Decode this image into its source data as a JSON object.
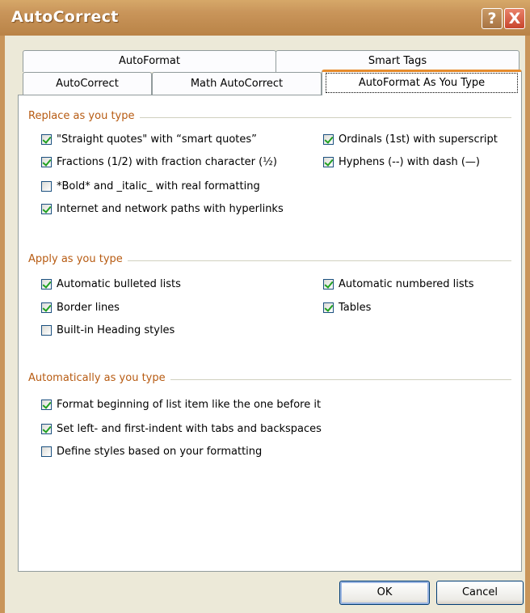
{
  "window": {
    "title": "AutoCorrect",
    "help_symbol": "?",
    "close_symbol": "X"
  },
  "tabs": {
    "row1": [
      {
        "label": "AutoFormat"
      },
      {
        "label": "Smart Tags"
      }
    ],
    "row2": [
      {
        "label": "AutoCorrect"
      },
      {
        "label": "Math AutoCorrect"
      },
      {
        "label": "AutoFormat As You Type",
        "active": true
      }
    ]
  },
  "sections": {
    "replace": {
      "title": "Replace as you type",
      "items": [
        {
          "label": "\"Straight quotes\" with “smart quotes”",
          "checked": true
        },
        {
          "label": "Ordinals (1st) with superscript",
          "checked": true
        },
        {
          "label": "Fractions (1/2) with fraction character (½)",
          "checked": true
        },
        {
          "label": "Hyphens (--) with dash (—)",
          "checked": true
        },
        {
          "label": "*Bold* and _italic_ with real formatting",
          "checked": false
        },
        {
          "label": "Internet and network paths with hyperlinks",
          "checked": true
        }
      ]
    },
    "apply": {
      "title": "Apply as you type",
      "items": [
        {
          "label": "Automatic bulleted lists",
          "checked": true
        },
        {
          "label": "Automatic numbered lists",
          "checked": true
        },
        {
          "label": "Border lines",
          "checked": true
        },
        {
          "label": "Tables",
          "checked": true
        },
        {
          "label": "Built-in Heading styles",
          "checked": false
        }
      ]
    },
    "auto": {
      "title": "Automatically as you type",
      "items": [
        {
          "label": "Format beginning of list item like the one before it",
          "checked": true
        },
        {
          "label": "Set left- and first-indent with tabs and backspaces",
          "checked": true
        },
        {
          "label": "Define styles based on your formatting",
          "checked": false
        }
      ]
    }
  },
  "buttons": {
    "ok": "OK",
    "cancel": "Cancel"
  }
}
